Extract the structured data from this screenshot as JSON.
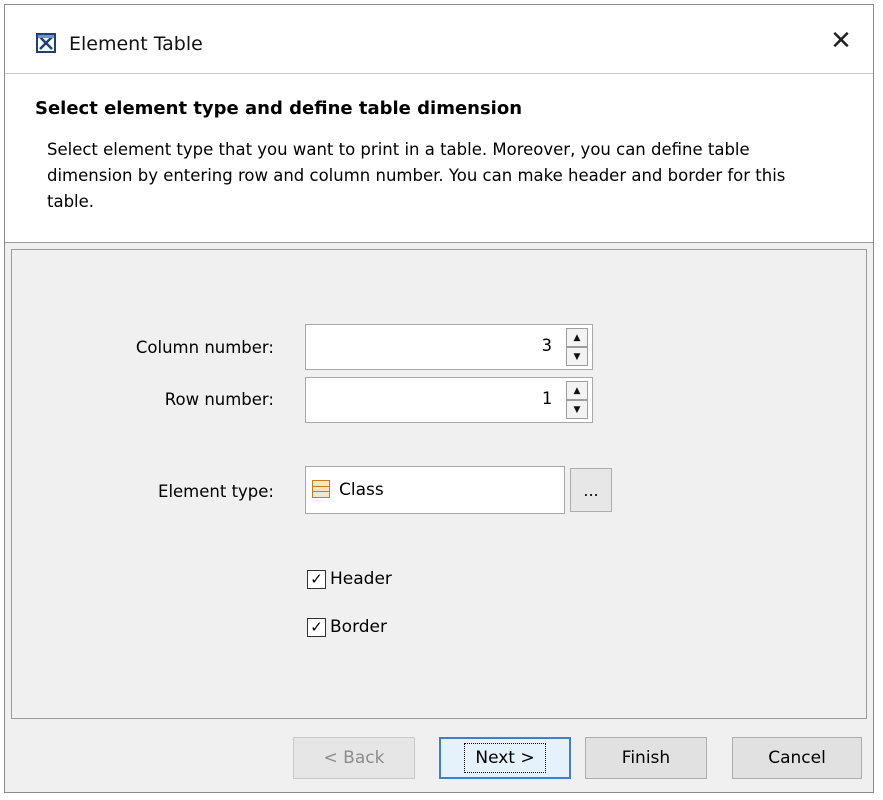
{
  "window": {
    "title": "Element Table",
    "close_glyph": "✕"
  },
  "header": {
    "title": "Select element type and define table dimension",
    "description": "Select element type that you want to print in a table. Moreover, you can define table dimension by entering row and column number. You can make header and border for this table."
  },
  "form": {
    "column_label": "Column number:",
    "column_value": "3",
    "row_label": "Row number:",
    "row_value": "1",
    "element_type_label": "Element type:",
    "element_type_value": "Class",
    "element_type_icon": "class-icon",
    "browse_label": "...",
    "header_label": "Header",
    "header_checked": true,
    "border_label": "Border",
    "border_checked": true
  },
  "buttons": {
    "back": "< Back",
    "next": "Next >",
    "finish": "Finish",
    "cancel": "Cancel"
  },
  "colors": {
    "focus_accent": "#3c7fd1",
    "class_icon_fill": "#fbe4c6",
    "class_icon_border": "#c77a1e"
  }
}
